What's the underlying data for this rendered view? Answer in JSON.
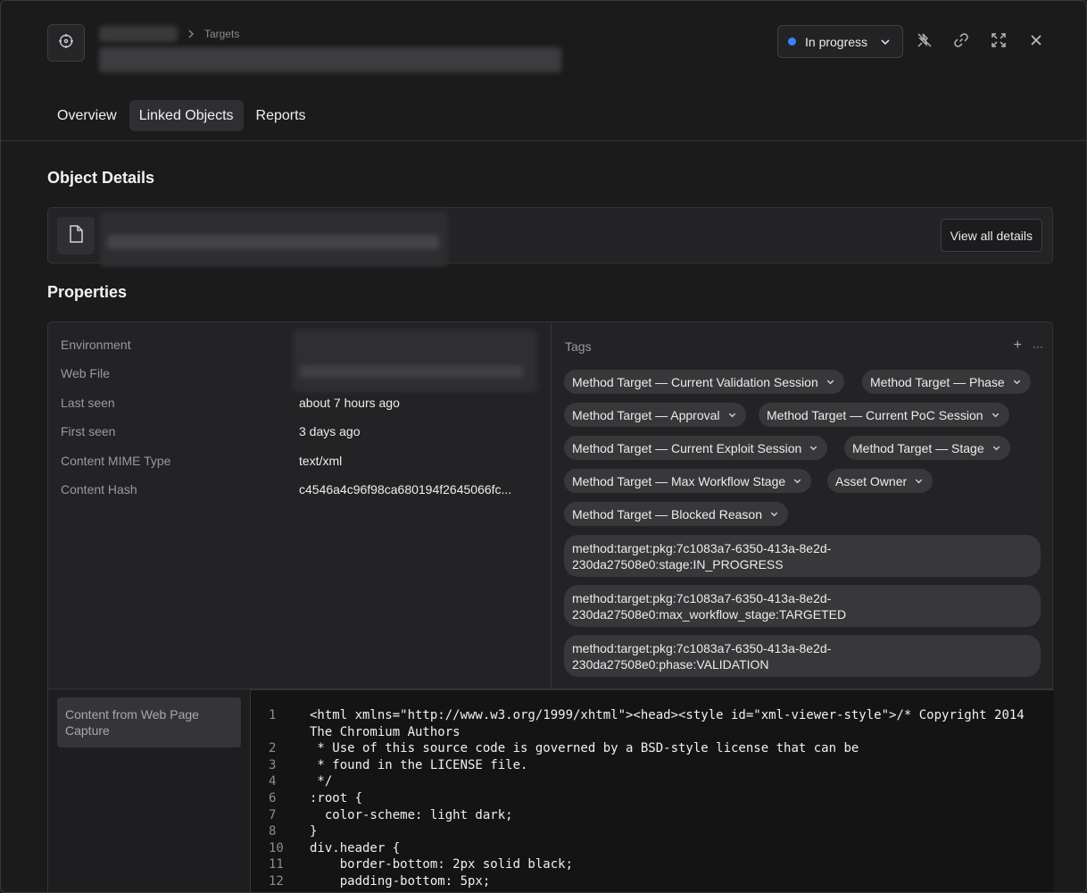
{
  "header": {
    "breadcrumb_label": "Targets",
    "status": {
      "label": "In progress",
      "dot_color": "#3b82f6"
    },
    "actions": [
      "unpin-icon",
      "link-icon",
      "expand-icon",
      "close-icon"
    ]
  },
  "tabs": [
    {
      "label": "Overview",
      "active": false
    },
    {
      "label": "Linked Objects",
      "active": true
    },
    {
      "label": "Reports",
      "active": false
    }
  ],
  "object_details": {
    "title": "Object Details",
    "view_all_label": "View all details"
  },
  "properties": {
    "title": "Properties",
    "rows": [
      {
        "label": "Environment",
        "value": ""
      },
      {
        "label": "Web File",
        "value": ""
      },
      {
        "label": "Last seen",
        "value": "about 7 hours ago"
      },
      {
        "label": "First seen",
        "value": "3 days ago"
      },
      {
        "label": "Content MIME Type",
        "value": "text/xml"
      },
      {
        "label": "Content Hash",
        "value": "c4546a4c96f98ca680194f2645066fc..."
      }
    ]
  },
  "tags": {
    "title": "Tags",
    "add_label": "+",
    "more_label": "···",
    "chips": [
      "Method Target — Current Validation Session",
      "Method Target — Phase",
      "Method Target — Approval",
      "Method Target — Current PoC Session",
      "Method Target — Current Exploit Session",
      "Method Target — Stage",
      "Method Target — Max Workflow Stage",
      "Asset Owner",
      "Method Target — Blocked Reason"
    ],
    "long_tags": [
      [
        "method:target:pkg:7c1083a7-6350-413a-8e2d-",
        "230da27508e0:stage:IN_PROGRESS"
      ],
      [
        "method:target:pkg:7c1083a7-6350-413a-8e2d-",
        "230da27508e0:max_workflow_stage:TARGETED"
      ],
      [
        "method:target:pkg:7c1083a7-6350-413a-8e2d-",
        "230da27508e0:phase:VALIDATION"
      ]
    ]
  },
  "content": {
    "side_label": "Content from Web Page Capture",
    "code_lines": [
      {
        "n": "1",
        "text": "<html xmlns=\"http://www.w3.org/1999/xhtml\"><head><style id=\"xml-viewer-style\">/* Copyright 2014"
      },
      {
        "n": "",
        "text": "The Chromium Authors"
      },
      {
        "n": "2",
        "text": " * Use of this source code is governed by a BSD-style license that can be"
      },
      {
        "n": "3",
        "text": " * found in the LICENSE file."
      },
      {
        "n": "4",
        "text": " */"
      },
      {
        "n": "6",
        "text": ":root {"
      },
      {
        "n": "7",
        "text": "  color-scheme: light dark;"
      },
      {
        "n": "8",
        "text": "}"
      },
      {
        "n": "10",
        "text": "div.header {"
      },
      {
        "n": "11",
        "text": "    border-bottom: 2px solid black;"
      },
      {
        "n": "12",
        "text": "    padding-bottom: 5px;"
      }
    ]
  }
}
